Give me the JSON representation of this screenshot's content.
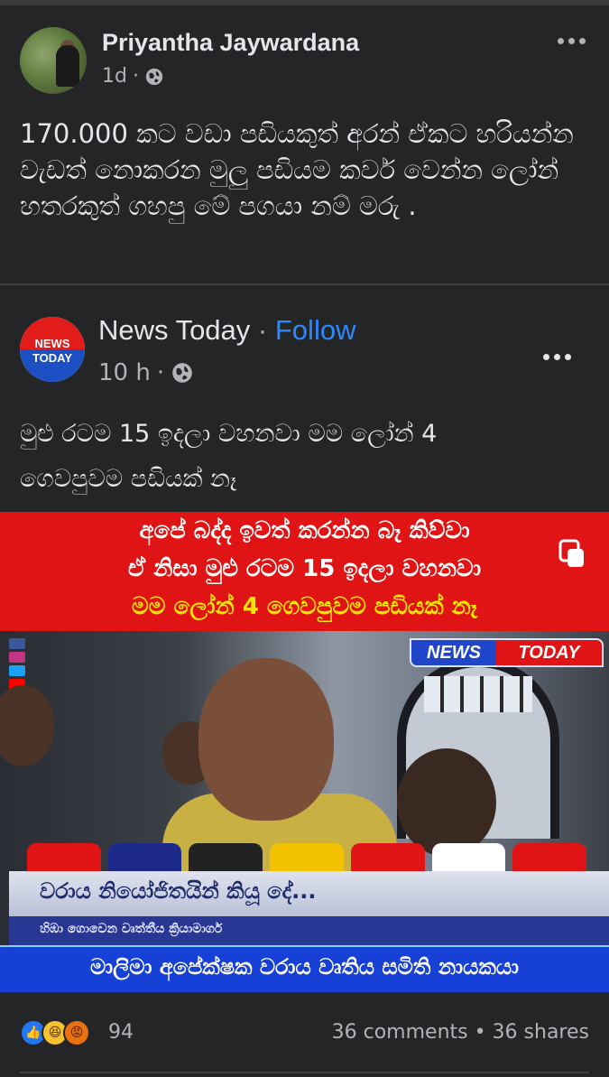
{
  "post": {
    "author": "Priyantha Jaywardana",
    "time": "1d",
    "dot": "·",
    "text": "170.000 කට වඩා පඩියකුත් අරන් ඒකට හරියන්න වැඩත් නොකරන  මුලු පඩියම කවර් වෙන්න ලෝන් හතරකුත් ගහපු මේ පගයා නම් මරු .",
    "privacy_icon": "globe-icon",
    "menu_icon": "more-icon"
  },
  "shared": {
    "page_name": "News Today",
    "separator": "·",
    "follow_label": "Follow",
    "logo_top": "NEWS",
    "logo_bottom": "TODAY",
    "time": "10 h",
    "dot": "·",
    "text_line1": "මුළු රටම 15 ඉදලා වහනවා  මම ලෝන් 4",
    "text_line2": "ගෙවපුවම පඩියක් නෑ",
    "privacy_icon": "globe-icon",
    "menu_icon": "more-icon"
  },
  "image": {
    "banner_line1": "අපේ බද්ද ඉවත් කරන්න බෑ කිව්වා",
    "banner_line2": "ඒ නිසා මුළු රටම 15 ඉදලා වහනවා",
    "banner_line3": "මම ලෝන් 4 ගෙවපුවම පඩියක් නෑ",
    "logo_news": "NEWS",
    "logo_today": "TODAY",
    "lower_third_1": "වරාය නියෝජිතයින් කියූ දේ...",
    "lower_third_2": "හිඹා ගොවෙන වෘත්තීය ක්‍රියාමාර්ග",
    "lower_third_3": "මාලිමා අපේක්ෂක වරාය වෘතිය සමිති නායකයා"
  },
  "footer": {
    "reaction_count": "94",
    "comments_shares": "36 comments • 36 shares",
    "reactions": [
      "like",
      "haha",
      "angry"
    ]
  }
}
